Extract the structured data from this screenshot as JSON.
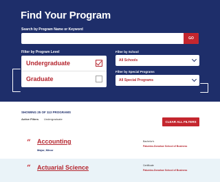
{
  "search": {
    "title": "Find Your Program",
    "label": "Search by Program Name or Keyword",
    "input_value": "",
    "go_label": "GO"
  },
  "filters": {
    "level_label": "Filter by Program Level",
    "levels": [
      {
        "label": "Undergraduate",
        "checked": true
      },
      {
        "label": "Graduate",
        "checked": false
      }
    ],
    "school_label": "Filter by School",
    "school_value": "All Schools",
    "special_label": "Filter by Special Programs",
    "special_value": "All Special Programs"
  },
  "results": {
    "showing_text": "SHOWING 25 OF 113 PROGRAMS",
    "active_filters_label": "Active Filters",
    "active_filter_value": "Undergraduate",
    "clear_label": "CLEAR ALL FILTERS",
    "programs": [
      {
        "name": "Accounting",
        "meta": "Major, Minor",
        "degree_type": "Bachelor's",
        "college": "Palumbo-Donahue School of Business"
      },
      {
        "name": "Actuarial Science",
        "meta": "",
        "degree_type": "Certificate",
        "college": "Palumbo-Donahue School of Business"
      }
    ]
  },
  "colors": {
    "navy": "#1e2e6a",
    "red": "#c4262e",
    "light_blue": "#eaf3f8"
  }
}
